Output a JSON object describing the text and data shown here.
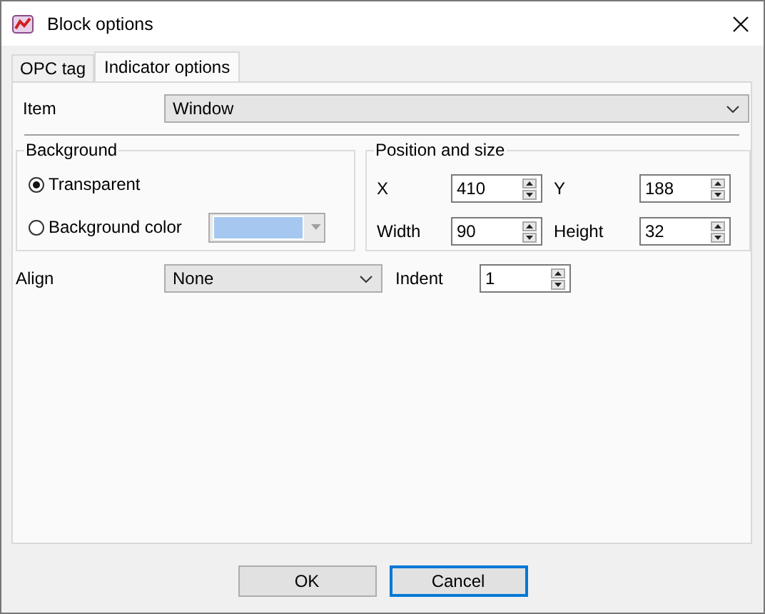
{
  "window": {
    "title": "Block options"
  },
  "tabs": [
    {
      "label": "OPC tag",
      "selected": false
    },
    {
      "label": "Indicator options",
      "selected": true
    }
  ],
  "item": {
    "label": "Item",
    "value": "Window"
  },
  "background": {
    "title": "Background",
    "options": [
      {
        "label": "Transparent",
        "selected": true
      },
      {
        "label": "Background color",
        "selected": false
      }
    ],
    "color": "#a6c8f0",
    "color_disabled": true
  },
  "position": {
    "title": "Position and size",
    "fields": [
      {
        "label": "X",
        "value": "410"
      },
      {
        "label": "Y",
        "value": "188"
      },
      {
        "label": "Width",
        "value": "90"
      },
      {
        "label": "Height",
        "value": "32"
      }
    ]
  },
  "align": {
    "label": "Align",
    "value": "None"
  },
  "indent": {
    "label": "Indent",
    "value": "1"
  },
  "buttons": [
    {
      "label": "OK",
      "focused": false
    },
    {
      "label": "Cancel",
      "focused": true
    }
  ]
}
